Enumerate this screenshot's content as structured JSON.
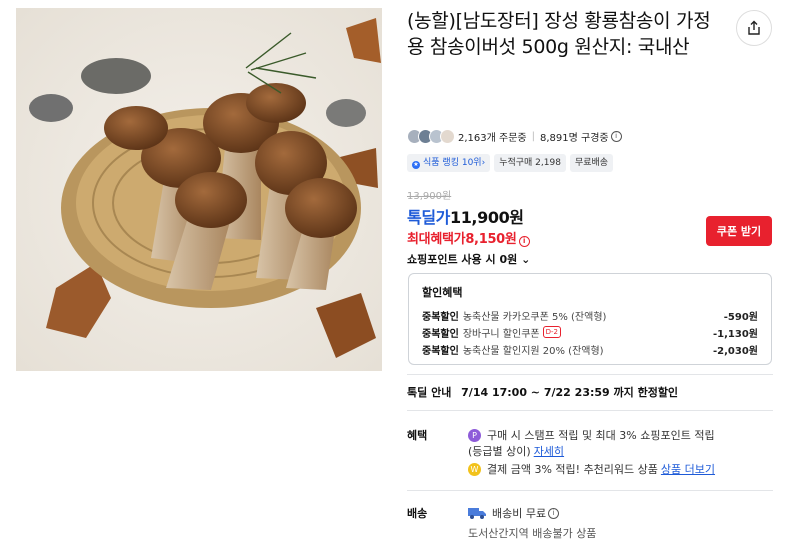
{
  "product": {
    "title": "(농할)[남도장터] 장성 황룡참송이 가정용 참송이버섯 500g 원산지: 국내산"
  },
  "stats": {
    "orders": "2,163개 주문중",
    "wishlist": "8,891명 구경중"
  },
  "badges": {
    "rank": "식품 랭킹 10위",
    "cumulative": "누적구매 2,198",
    "shipping": "무료배송"
  },
  "price": {
    "original": "13,900원",
    "deal_label": "톡딜가",
    "deal_price": "11,900원",
    "max_label": "최대혜택가",
    "max_price": "8,150원",
    "coupon_button": "쿠폰 받기",
    "points": "쇼핑포인트 사용 시 0원"
  },
  "discounts": {
    "header": "할인혜택",
    "rows": [
      {
        "tag": "중복할인",
        "desc": "농축산물 카카오쿠폰 5% (잔액형)",
        "amount": "-590원"
      },
      {
        "tag": "중복할인",
        "desc": "장바구니 할인쿠폰",
        "badge": "D-2",
        "amount": "-1,130원"
      },
      {
        "tag": "중복할인",
        "desc": "농축산물 할인지원 20% (잔액형)",
        "amount": "-2,030원"
      }
    ]
  },
  "deal_info": {
    "label": "톡딜 안내",
    "text": "7/14 17:00 ~ 7/22 23:59 까지 한정할인"
  },
  "benefits": {
    "label": "혜택",
    "line1": "구매 시 스탬프 적립 및 최대 3% 쇼핑포인트 적립",
    "line1b": "(등급별 상이)",
    "line1_link": "자세히",
    "line2": "결제 금액 3% 적립! 추천리워드 상품",
    "line2_link": "상품 더보기",
    "coin1": "P",
    "coin2": "W"
  },
  "shipping": {
    "label": "배송",
    "fee": "배송비 무료",
    "note": "도서산간지역 배송불가 상품"
  },
  "colors": {
    "accent_blue": "#1e5bd8",
    "accent_red": "#e8212e",
    "point_purple": "#8e5cd9",
    "reward_yellow": "#f2c21b"
  }
}
